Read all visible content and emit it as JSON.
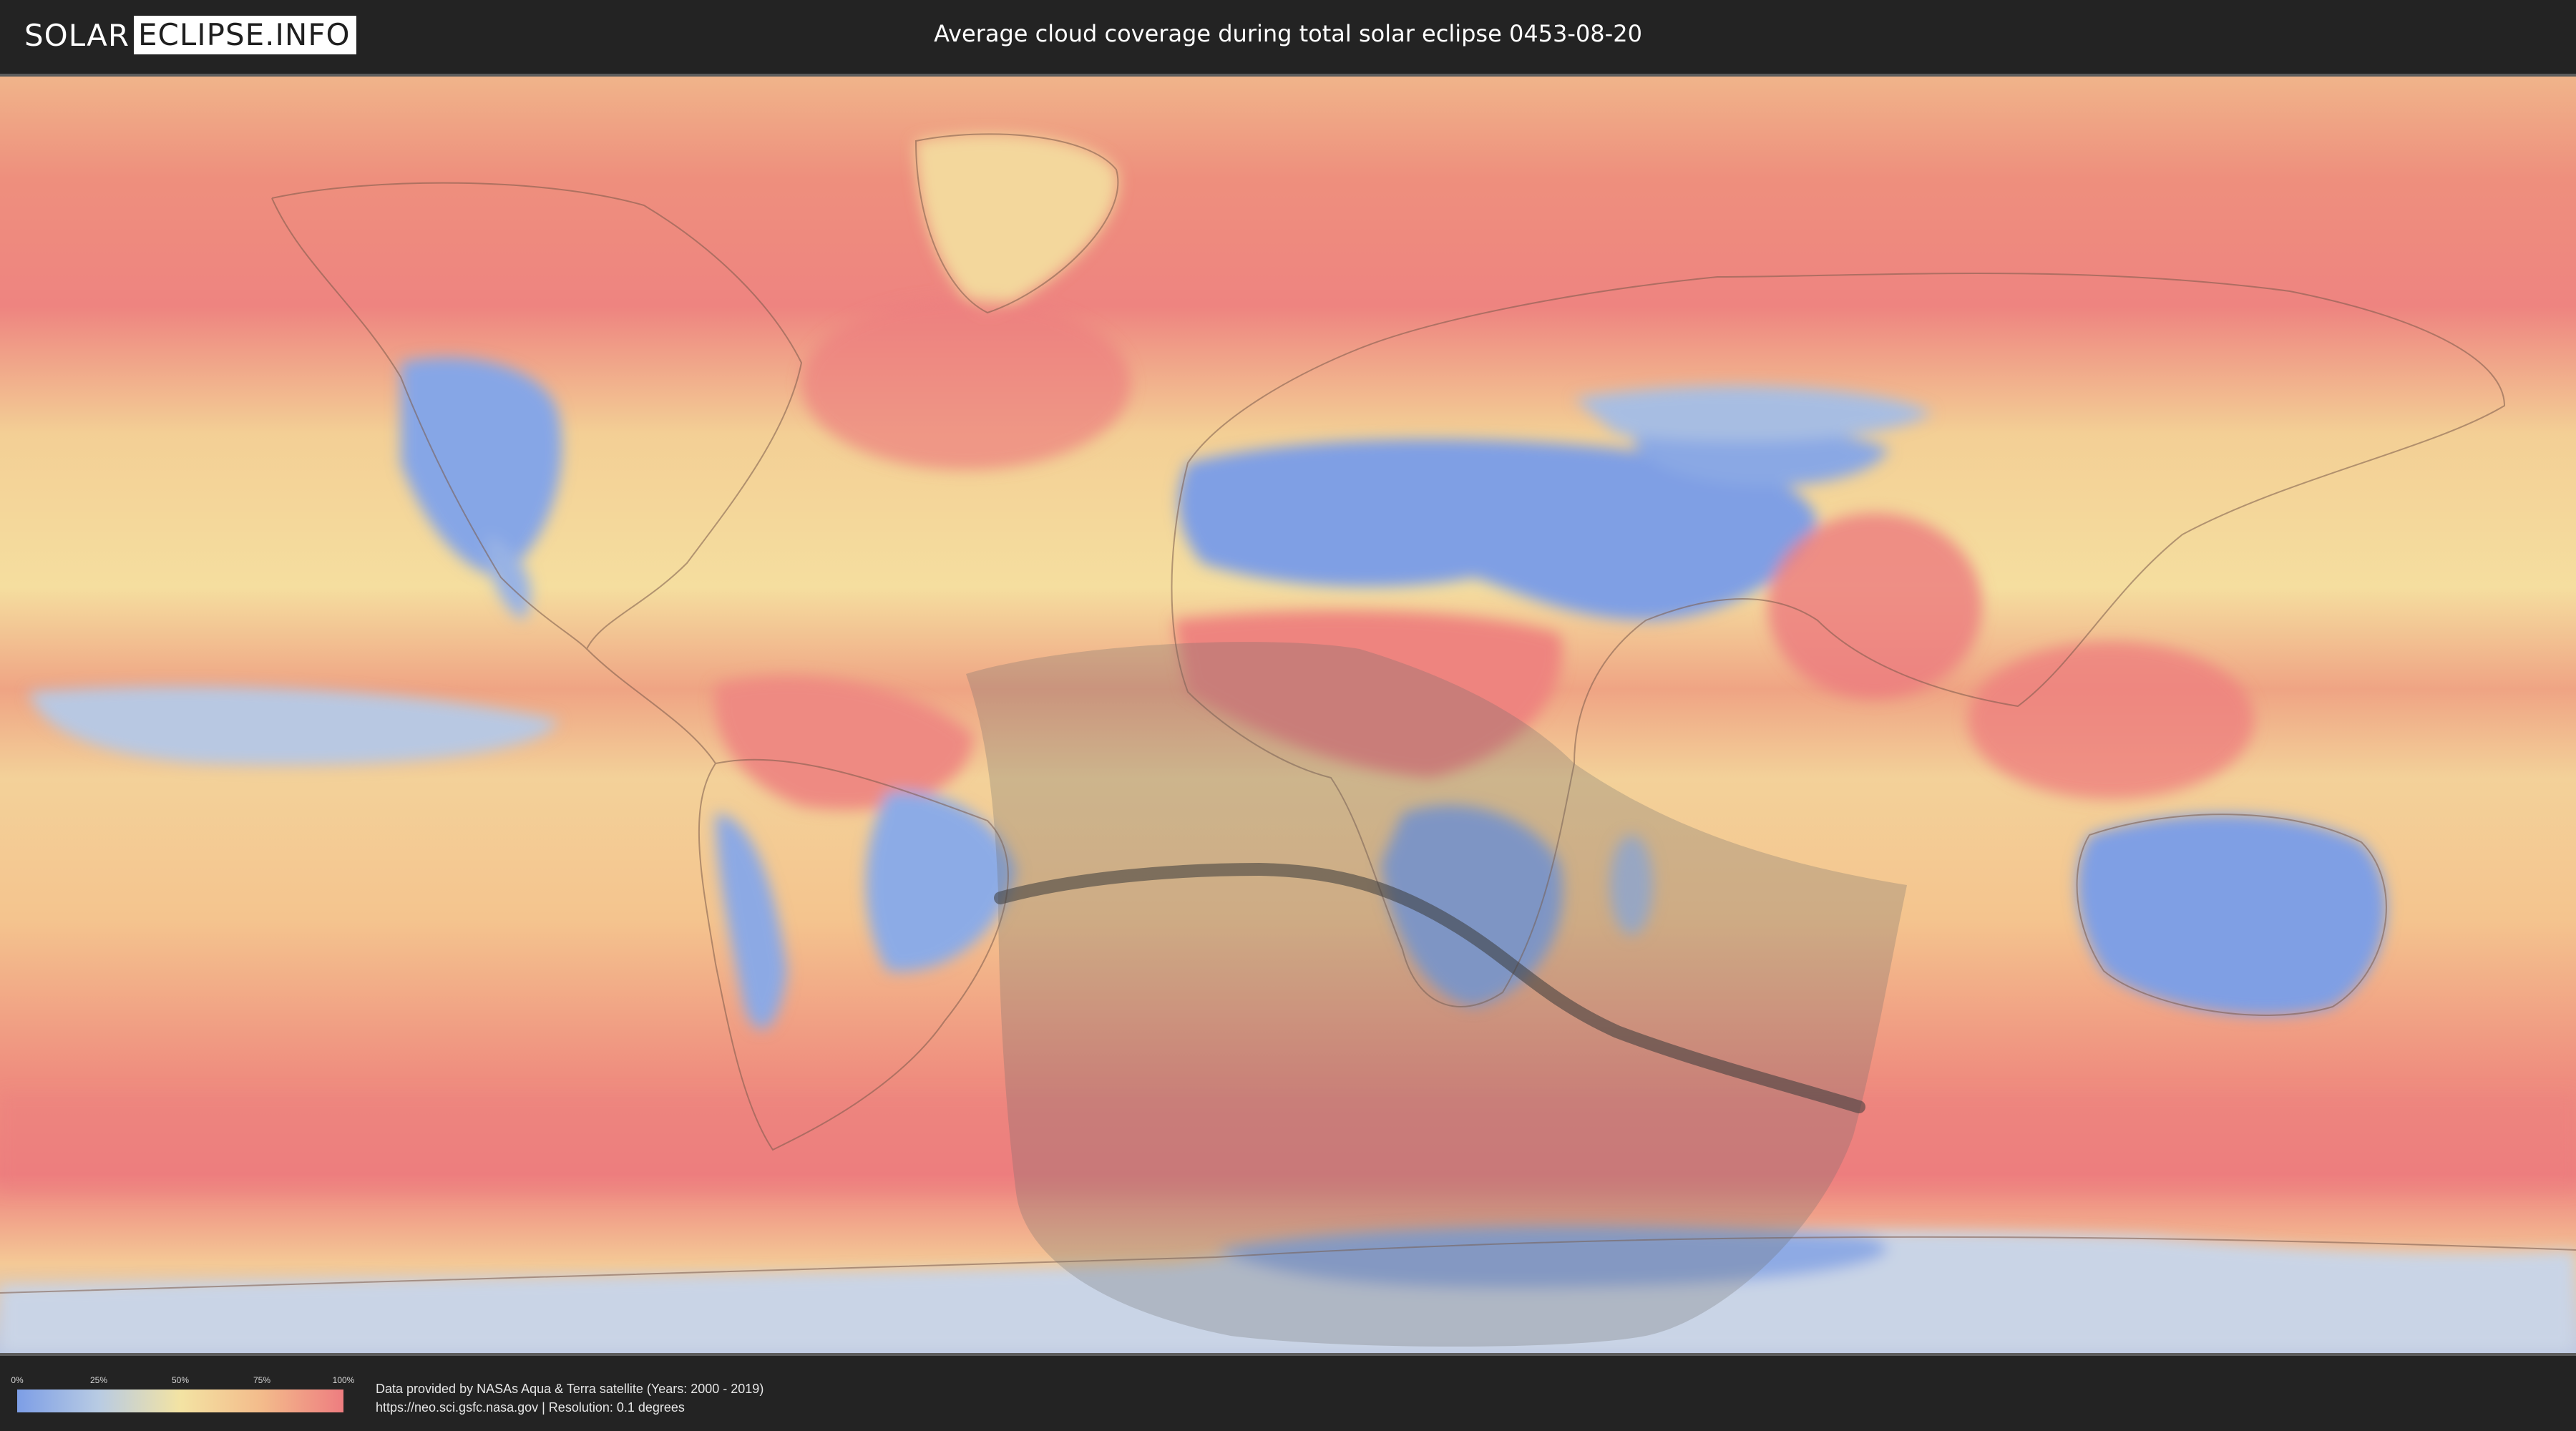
{
  "header": {
    "logo_left": "SOLAR",
    "logo_right": "ECLIPSE.INFO",
    "title": "Average cloud coverage during total solar eclipse 0453-08-20"
  },
  "legend": {
    "ticks": [
      "0%",
      "25%",
      "50%",
      "75%",
      "100%"
    ],
    "colors": {
      "low": "#7d9ee6",
      "mid": "#f3e3a3",
      "high": "#ee7d80"
    }
  },
  "credits": {
    "line1": "Data provided by NASAs Aqua & Terra satellite (Years: 2000 - 2019)",
    "line2": "https://neo.sci.gsfc.nasa.gov | Resolution: 0.1 degrees"
  },
  "map": {
    "eclipse_shadow_color": "#6b6b6b",
    "central_line_color": "#3a3a3a"
  }
}
